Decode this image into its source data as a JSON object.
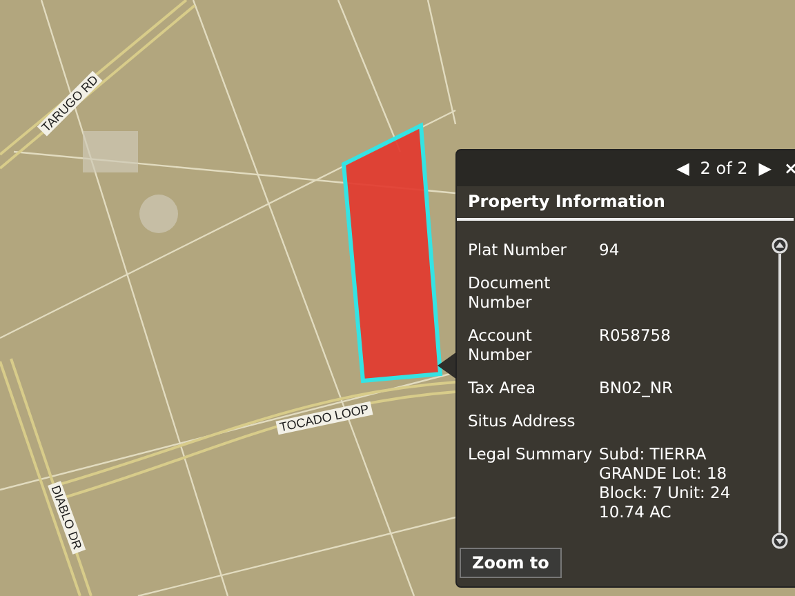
{
  "map": {
    "road_labels": [
      {
        "text": "TARUGO RD"
      },
      {
        "text": "TOCADO LOOP"
      },
      {
        "text": "DIABLO DR"
      }
    ]
  },
  "popup": {
    "pager": {
      "prev": "◀",
      "text": "2 of 2",
      "next": "▶",
      "close": "×"
    },
    "title": "Property Information",
    "fields": [
      {
        "label": "Plat Number",
        "value": "94"
      },
      {
        "label": "Document Number"
      },
      {
        "label": "Account Number",
        "value": "R058758"
      },
      {
        "label": "Tax Area",
        "value": "BN02_NR"
      },
      {
        "label": "Situs Address"
      },
      {
        "label": "Legal Summary",
        "value": "Subd: TIERRA GRANDE Lot: 18 Block: 7 Unit: 24 10.74 AC"
      }
    ],
    "button": "Zoom to"
  }
}
